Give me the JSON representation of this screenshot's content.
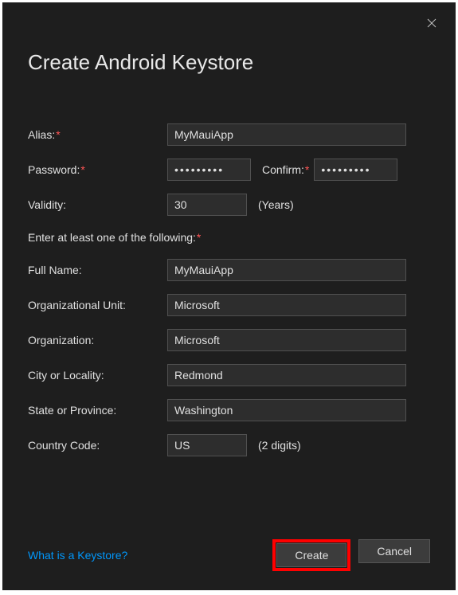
{
  "dialog": {
    "title": "Create Android Keystore"
  },
  "fields": {
    "alias_label": "Alias:",
    "alias_value": "MyMauiApp",
    "password_label": "Password:",
    "password_value": "•••••••••",
    "confirm_label": "Confirm:",
    "confirm_value": "•••••••••",
    "validity_label": "Validity:",
    "validity_value": "30",
    "validity_suffix": "(Years)",
    "section_label": "Enter at least one of the following:",
    "fullname_label": "Full Name:",
    "fullname_value": "MyMauiApp",
    "orgunit_label": "Organizational Unit:",
    "orgunit_value": "Microsoft",
    "org_label": "Organization:",
    "org_value": "Microsoft",
    "city_label": "City or Locality:",
    "city_value": "Redmond",
    "state_label": "State or Province:",
    "state_value": "Washington",
    "country_label": "Country Code:",
    "country_value": "US",
    "country_suffix": "(2 digits)"
  },
  "footer": {
    "help_link": "What is a Keystore?",
    "create_button": "Create",
    "cancel_button": "Cancel"
  },
  "required_marker": "*"
}
